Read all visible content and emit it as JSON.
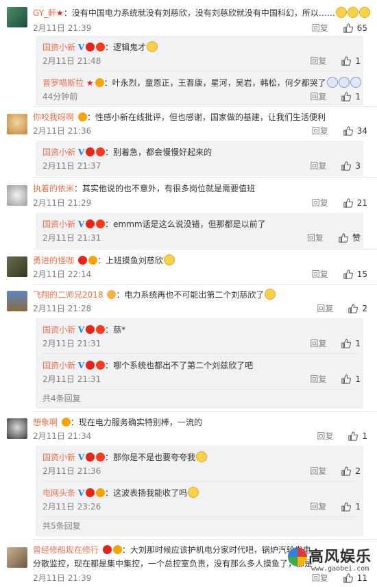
{
  "colors": {
    "username": "#eb7350",
    "meta": "#808080",
    "sub_bg": "#f2f2f5"
  },
  "reply_label": "回复",
  "comments": [
    {
      "user": "GY_軒",
      "sep": "：",
      "text": "没有中国电力系统就没有刘慈欣，没有刘慈欣就没有中国科幻，所以……",
      "time": "2月11日 21:39",
      "likes": "65",
      "replies": [
        {
          "user": "国资小新",
          "sep": "：",
          "text": "逻辑鬼才",
          "time": "2月11日 21:48",
          "likes": "1"
        },
        {
          "user": "普罗喵斯拉",
          "sep": "：",
          "text": "叶永烈，童恩正，王晋康，星河，吴岩，韩松，何夕都哭了",
          "time": "44分钟前",
          "likes": "1"
        }
      ]
    },
    {
      "user": "你咬我呀啊",
      "sep": "：",
      "text": "性感小新在线批评，但也感谢，国家做的基建，让我们生活便利",
      "time": "2月11日 21:36",
      "likes": "34",
      "replies": [
        {
          "user": "国资小新",
          "sep": "：",
          "text": "别着急，都会慢慢好起来的",
          "time": "2月11日 21:37",
          "likes": "3"
        }
      ]
    },
    {
      "user": "执着的依米",
      "sep": "：",
      "text": "其实他说的也不意外，有很多岗位就是需要值班",
      "time": "2月11日 21:29",
      "likes": "21",
      "replies": [
        {
          "user": "国资小新",
          "sep": "：",
          "text": "emmm话是这么说没错，但那都是以前了",
          "time": "2月11日 21:31",
          "likes": "赞"
        }
      ]
    },
    {
      "user": "勇进的怪咖",
      "sep": "：",
      "text": "上班摸鱼刘慈欣",
      "time": "2月11日 22:14",
      "likes": "15",
      "replies": []
    },
    {
      "user": "飞翔的二师兄2018",
      "sep": "：",
      "text": "电力系统再也不可能出第二个刘慈欣了",
      "time": "2月11日 21:28",
      "likes": "2",
      "replies": [
        {
          "user": "国资小新",
          "sep": "：",
          "text": "慈*",
          "time": "2月11日 21:31",
          "likes": "1"
        },
        {
          "user": "国资小新",
          "sep": "：",
          "text": "哪个系统也都出不了第二个刘兹欣了吧",
          "time": "2月11日 21:31",
          "likes": "1"
        }
      ],
      "more": "共4条回复"
    },
    {
      "user": "想象啊",
      "sep": "：",
      "text": "现在电力服务确实特别棒，一流的",
      "time": "2月11日 21:34",
      "likes": "1",
      "replies": [
        {
          "user": "国资小新",
          "sep": "：",
          "text": "那你是不是也要夸夸我",
          "time": "2月11日 21:36",
          "likes": "2"
        },
        {
          "user": "电网头条",
          "sep": "：",
          "text": "这波表扬我能收了吗",
          "time": "2月11日 23:26",
          "likes": "1"
        }
      ],
      "more": "共5条回复"
    },
    {
      "user": "曾经修船现在修行",
      "sep": "：",
      "text": "大刘那时候应该护机电分家时代吧，锅炉汽轮发电",
      "text2": "分散监控，现在都是集中集控，一个总控室负责，没有那么多人摸鱼了，都是",
      "time": "2月11日 21:39",
      "likes": "11",
      "replies": []
    }
  ],
  "watermark": {
    "name": "高风娱乐",
    "url": "www.gaobei.com"
  }
}
